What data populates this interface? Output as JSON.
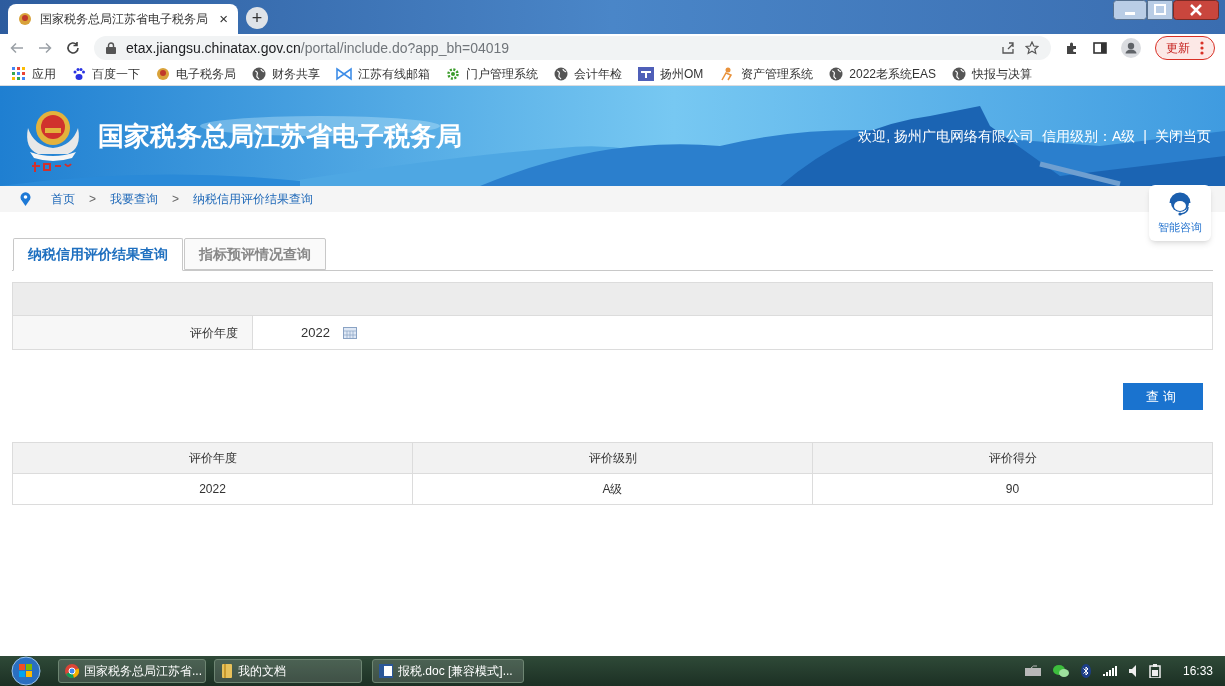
{
  "browser": {
    "tab_title": "国家税务总局江苏省电子税务局",
    "tab_close": "×",
    "new_tab": "+",
    "url_host": "etax.jiangsu.chinatax.gov.cn",
    "url_path": "/portal/include.do?app_bh=04019",
    "update_button": "更新",
    "bookmarks": [
      {
        "label": "应用",
        "kind": "apps"
      },
      {
        "label": "百度一下",
        "kind": "paw"
      },
      {
        "label": "电子税务局",
        "kind": "emblem"
      },
      {
        "label": "财务共享",
        "kind": "globe"
      },
      {
        "label": "江苏有线邮箱",
        "kind": "mail"
      },
      {
        "label": "门户管理系统",
        "kind": "gear"
      },
      {
        "label": "会计年检",
        "kind": "globe"
      },
      {
        "label": "扬州OM",
        "kind": "td"
      },
      {
        "label": "资产管理系统",
        "kind": "figure"
      },
      {
        "label": "2022老系统EAS",
        "kind": "globe"
      },
      {
        "label": "快报与决算",
        "kind": "globe"
      }
    ]
  },
  "header": {
    "site_title": "国家税务总局江苏省电子税务局",
    "welcome": "欢迎, 扬州广电网络有限公司",
    "credit": "信用级别：A级",
    "separator": "|",
    "close_link": "关闭当页"
  },
  "breadcrumb": [
    {
      "label": "首页",
      "kind": "link"
    },
    {
      "label": ">",
      "kind": "sep"
    },
    {
      "label": "我要查询",
      "kind": "link"
    },
    {
      "label": ">",
      "kind": "sep"
    },
    {
      "label": "纳税信用评价结果查询",
      "kind": "link"
    }
  ],
  "assistant": {
    "label": "智能咨询"
  },
  "tabs": [
    {
      "label": "纳税信用评价结果查询",
      "selected": true
    },
    {
      "label": "指标预评情况查询",
      "selected": false
    }
  ],
  "form": {
    "label": "评价年度",
    "value": "2022"
  },
  "query_button": "查询",
  "table": {
    "columns": [
      "评价年度",
      "评价级别",
      "评价得分"
    ],
    "rows": [
      [
        "2022",
        "A级",
        "90"
      ]
    ]
  },
  "taskbar": {
    "items": [
      {
        "label": "国家税务总局江苏省...",
        "kind": "chrome"
      },
      {
        "label": "我的文档",
        "kind": "folder"
      },
      {
        "label": "报税.doc [兼容模式]...",
        "kind": "word"
      }
    ],
    "time": "16:33"
  }
}
